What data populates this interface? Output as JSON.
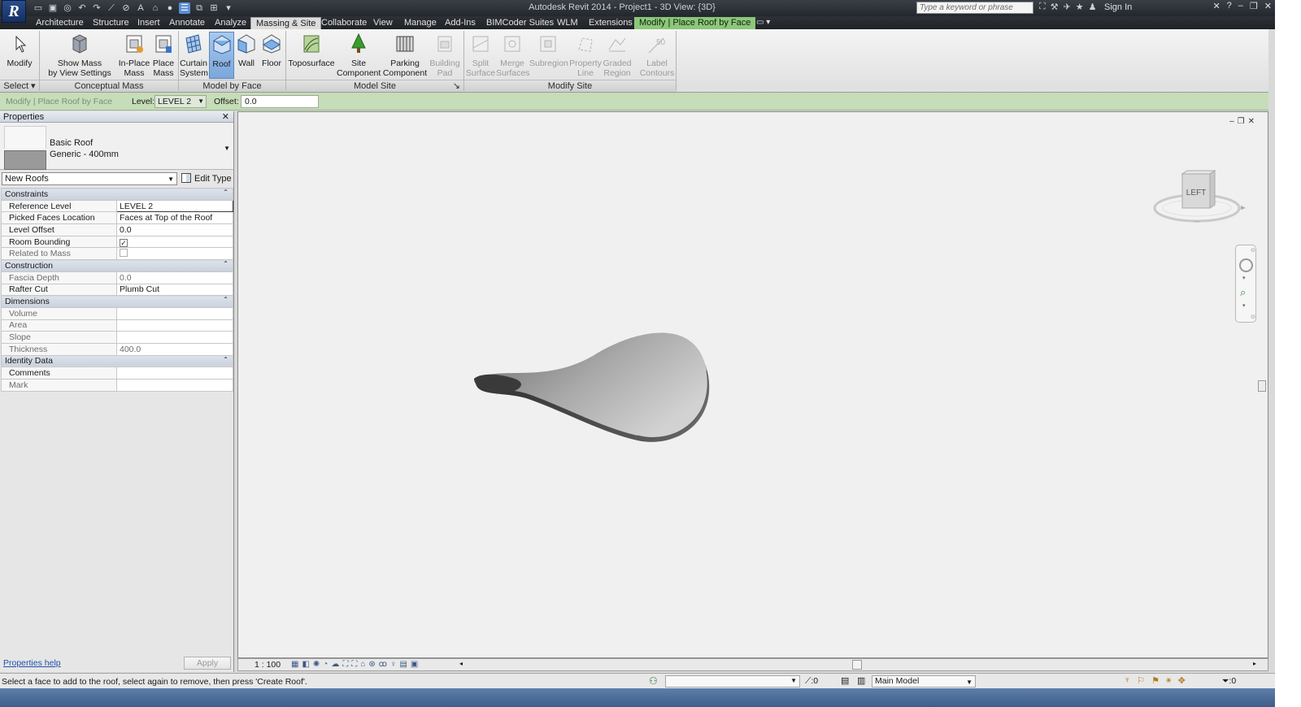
{
  "titlebar": {
    "title": "Autodesk Revit 2014 -     Project1 - 3D View: {3D}",
    "search_placeholder": "Type a keyword or phrase",
    "sign_in": "Sign In",
    "logo": "R"
  },
  "tabs": [
    {
      "label": "Architecture"
    },
    {
      "label": "Structure"
    },
    {
      "label": "Insert"
    },
    {
      "label": "Annotate"
    },
    {
      "label": "Analyze"
    },
    {
      "label": "Massing & Site"
    },
    {
      "label": "Collaborate"
    },
    {
      "label": "View"
    },
    {
      "label": "Manage"
    },
    {
      "label": "Add-Ins"
    },
    {
      "label": "BIMCoder Suites"
    },
    {
      "label": "WLM"
    },
    {
      "label": "Extensions"
    },
    {
      "label": "Modify | Place Roof by Face"
    }
  ],
  "ribbon": {
    "buttons": {
      "modify": "Modify",
      "show_mass_1": "Show Mass",
      "show_mass_2": "by View Settings",
      "inplace_1": "In-Place",
      "inplace_2": "Mass",
      "place_1": "Place",
      "place_2": "Mass",
      "curtain_1": "Curtain",
      "curtain_2": "System",
      "roof": "Roof",
      "wall": "Wall",
      "floor": "Floor",
      "toposurface": "Toposurface",
      "site_1": "Site",
      "site_2": "Component",
      "parking_1": "Parking",
      "parking_2": "Component",
      "building_1": "Building",
      "building_2": "Pad",
      "split_1": "Split",
      "split_2": "Surface",
      "merge_1": "Merge",
      "merge_2": "Surfaces",
      "subregion": "Subregion",
      "property_1": "Property",
      "property_2": "Line",
      "graded_1": "Graded",
      "graded_2": "Region",
      "label_1": "Label",
      "label_2": "Contours",
      "label_icon_text": "50"
    },
    "panels": {
      "select": "Select",
      "conceptual_mass": "Conceptual Mass",
      "model_by_face": "Model by Face",
      "model_site": "Model Site",
      "modify_site": "Modify Site"
    }
  },
  "options_bar": {
    "context": "Modify | Place Roof by Face",
    "level_label": "Level:",
    "level_value": "LEVEL 2",
    "offset_label": "Offset:",
    "offset_value": "0.0"
  },
  "properties": {
    "title": "Properties",
    "type_name": "Basic Roof",
    "type_sub": "Generic - 400mm",
    "instance_filter": "New Roofs",
    "edit_type": "Edit Type",
    "groups": {
      "constraints": "Constraints",
      "construction": "Construction",
      "dimensions": "Dimensions",
      "identity": "Identity Data"
    },
    "rows": {
      "reference_level": {
        "name": "Reference Level",
        "value": "LEVEL 2"
      },
      "picked_faces": {
        "name": "Picked Faces Location",
        "value": "Faces at Top of the Roof"
      },
      "level_offset": {
        "name": "Level Offset",
        "value": "0.0"
      },
      "room_bounding": {
        "name": "Room Bounding",
        "checked": true
      },
      "related_mass": {
        "name": "Related to Mass",
        "checked": false
      },
      "fascia_depth": {
        "name": "Fascia Depth",
        "value": "0.0"
      },
      "rafter_cut": {
        "name": "Rafter Cut",
        "value": "Plumb Cut"
      },
      "volume": {
        "name": "Volume",
        "value": ""
      },
      "area": {
        "name": "Area",
        "value": ""
      },
      "slope": {
        "name": "Slope",
        "value": ""
      },
      "thickness": {
        "name": "Thickness",
        "value": "400.0"
      },
      "comments": {
        "name": "Comments",
        "value": ""
      },
      "mark": {
        "name": "Mark",
        "value": ""
      }
    },
    "help_link": "Properties help",
    "apply": "Apply"
  },
  "viewport": {
    "viewcube_face": "LEFT"
  },
  "view_control_bar": {
    "scale": "1 : 100"
  },
  "statusbar": {
    "message": "Select a face to add to the roof, select again to remove, then press 'Create Roof'.",
    "selection_count": ":0",
    "model": "Main Model",
    "filter_count": ":0"
  },
  "colors": {
    "contextual_tab": "#8cc77a",
    "options_bar": "#c5ddb8",
    "pressed_button": "#7aa7dc",
    "titlebar": "#2b2f35"
  }
}
